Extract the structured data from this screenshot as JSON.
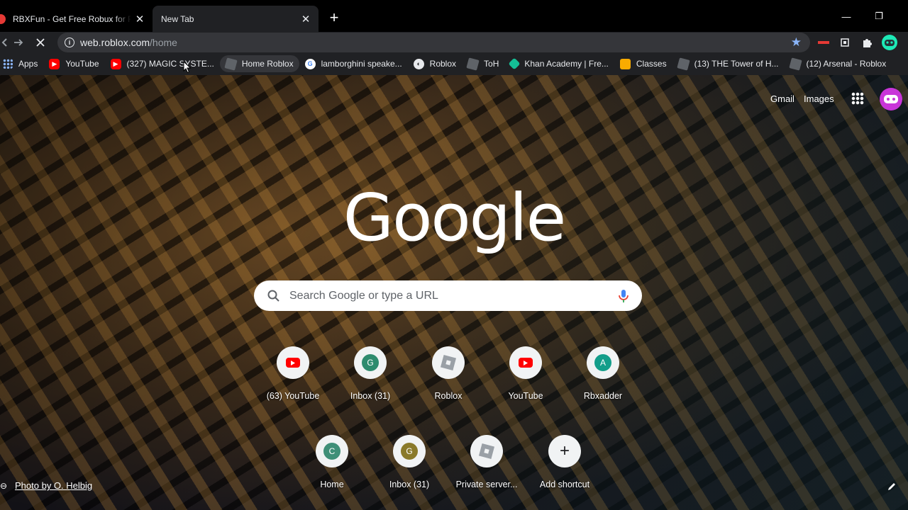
{
  "tabs": [
    {
      "title": "RBXFun - Get Free Robux for ROBLOX",
      "active": false
    },
    {
      "title": "New Tab",
      "active": true
    }
  ],
  "window_controls": {
    "minimize": "—",
    "restore": "❐",
    "close": "✕"
  },
  "toolbar": {
    "url_host": "web.roblox.com",
    "url_path": "/home"
  },
  "bookmarks": [
    {
      "label": "Apps",
      "icon": "apps-icon"
    },
    {
      "label": "YouTube",
      "icon": "youtube-icon"
    },
    {
      "label": "(327) MAGIC SYSTE...",
      "icon": "youtube-icon"
    },
    {
      "label": "Home Roblox",
      "icon": "roblox-icon"
    },
    {
      "label": "lamborghini speake...",
      "icon": "google-icon"
    },
    {
      "label": "Roblox",
      "icon": "globe-icon"
    },
    {
      "label": "ToH",
      "icon": "roblox-icon"
    },
    {
      "label": "Khan Academy | Fre...",
      "icon": "khan-icon"
    },
    {
      "label": "Classes",
      "icon": "classroom-icon"
    },
    {
      "label": "(13) THE Tower of H...",
      "icon": "roblox-icon"
    },
    {
      "label": "(12) Arsenal - Roblox",
      "icon": "roblox-icon"
    }
  ],
  "header": {
    "gmail": "Gmail",
    "images": "Images"
  },
  "logo": "Google",
  "search": {
    "placeholder": "Search Google or type a URL"
  },
  "shortcuts_row1": [
    {
      "label": "(63) YouTube",
      "icon": "youtube-icon"
    },
    {
      "label": "Inbox (31)",
      "icon": "letter-icon",
      "letter": "G",
      "color": "#2e8b6e"
    },
    {
      "label": "Roblox",
      "icon": "roblox-icon"
    },
    {
      "label": "YouTube",
      "icon": "youtube-icon"
    },
    {
      "label": "Rbxadder",
      "icon": "letter-icon",
      "letter": "A",
      "color": "#139e8a"
    }
  ],
  "shortcuts_row2": [
    {
      "label": "Home",
      "icon": "letter-icon",
      "letter": "C",
      "color": "#3f8f78"
    },
    {
      "label": "Inbox (31)",
      "icon": "letter-icon",
      "letter": "G",
      "color": "#8a7a2a"
    },
    {
      "label": "Private server...",
      "icon": "roblox-icon"
    },
    {
      "label": "Add shortcut",
      "icon": "plus-icon"
    }
  ],
  "photo_credit": "Photo by O. Helbig",
  "colors": {
    "accent": "#8ab4f8",
    "tab_active": "#202124",
    "chrome_bg": "#000000"
  }
}
